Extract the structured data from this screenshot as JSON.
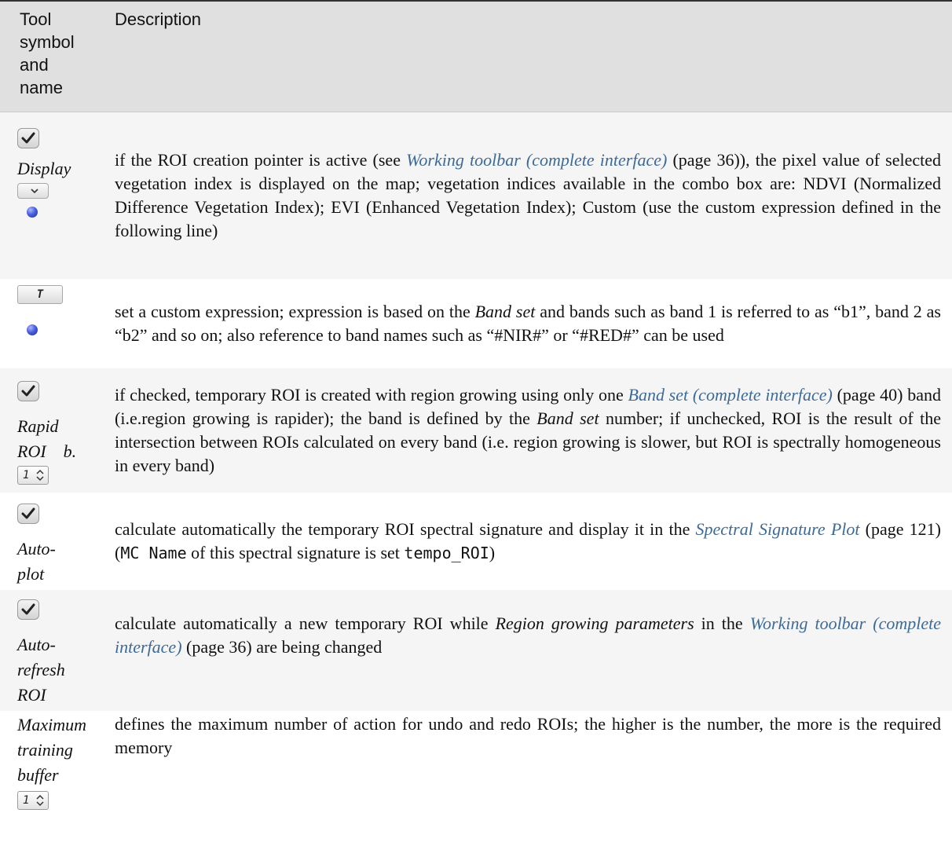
{
  "header": {
    "col1": "Tool symbol and name",
    "col2": "Description"
  },
  "rows": [
    {
      "name": "Display",
      "desc_pre": "if the ROI creation pointer is active (see ",
      "link1": "Working toolbar (complete interface)",
      "desc_mid1": " (page 36)), the pixel value of selected vegetation index is displayed on the map; vegetation indices available in the combo box are: NDVI (Normalized Difference Vegetation Index); EVI (Enhanced Vegetation Index); Custom (use the custom expression defined in the following line)"
    },
    {
      "button_text": "T",
      "desc_pre": "set a custom expression; expression is based on the ",
      "em1": "Band set",
      "desc_mid1": " and bands such as band 1 is referred to as “b1”, band 2 as “b2” and so on; also reference to band names such as “#NIR#” or “#RED#” can be used"
    },
    {
      "name": "Rapid ROI    b.",
      "spin_value": "1",
      "desc_pre": "if checked, temporary ROI is created with region growing using only one ",
      "link1": "Band set (complete interface)",
      "desc_mid1": " (page 40) band (i.e.region growing is rapider); the band is defined by the ",
      "em1": "Band set",
      "desc_mid2": " number; if unchecked, ROI is the result of the intersection between ROIs calculated on every band (i.e. region growing is slower, but ROI is spectrally homogeneous in every band)"
    },
    {
      "name": "Auto-plot",
      "desc_pre": "calculate automatically the temporary ROI spectral signature and display it in the ",
      "link1": "Spectral Signature Plot",
      "desc_mid1": " (page 121) (",
      "code1": "MC Name",
      "desc_mid2": " of this spectral signature is set ",
      "code2": "tempo_ROI",
      "desc_mid3": ")"
    },
    {
      "name": "Auto-refresh ROI",
      "desc_pre": "calculate automatically a new temporary ROI while ",
      "em1": "Region growing parameters",
      "desc_mid1": " in the ",
      "link1": "Working toolbar (complete interface)",
      "desc_mid2": " (page 36) are being changed"
    },
    {
      "name": "Maximum training buffer",
      "spin_value": "1",
      "desc_pre": "defines the maximum number of action for undo and redo ROIs; the higher is the number, the more is the required memory"
    }
  ]
}
